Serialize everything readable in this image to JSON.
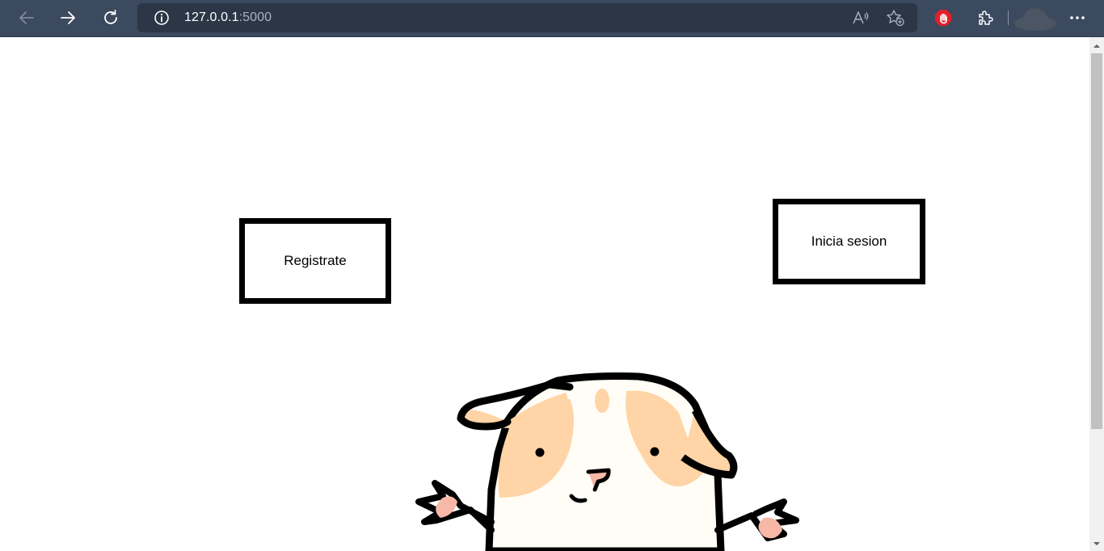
{
  "browser": {
    "address": {
      "host": "127.0.0.1",
      "port": ":5000"
    },
    "icons": {
      "back": "arrow-left-icon",
      "forward": "arrow-right-icon",
      "refresh": "refresh-icon",
      "site_info": "info-circle-icon",
      "read_aloud": "read-aloud-icon",
      "favorite": "star-add-icon",
      "adblock": "stop-hand-icon",
      "extensions": "puzzle-icon",
      "profile": "avatar-icon",
      "menu": "ellipsis-icon"
    },
    "colors": {
      "toolbar": "#3b4a5e",
      "address_bar": "#2b3647",
      "adblock": "#e3202a"
    }
  },
  "page": {
    "register_label": "Registrate",
    "login_label": "Inicia sesion",
    "mascot_icon": "guinea-pig-illustration"
  }
}
